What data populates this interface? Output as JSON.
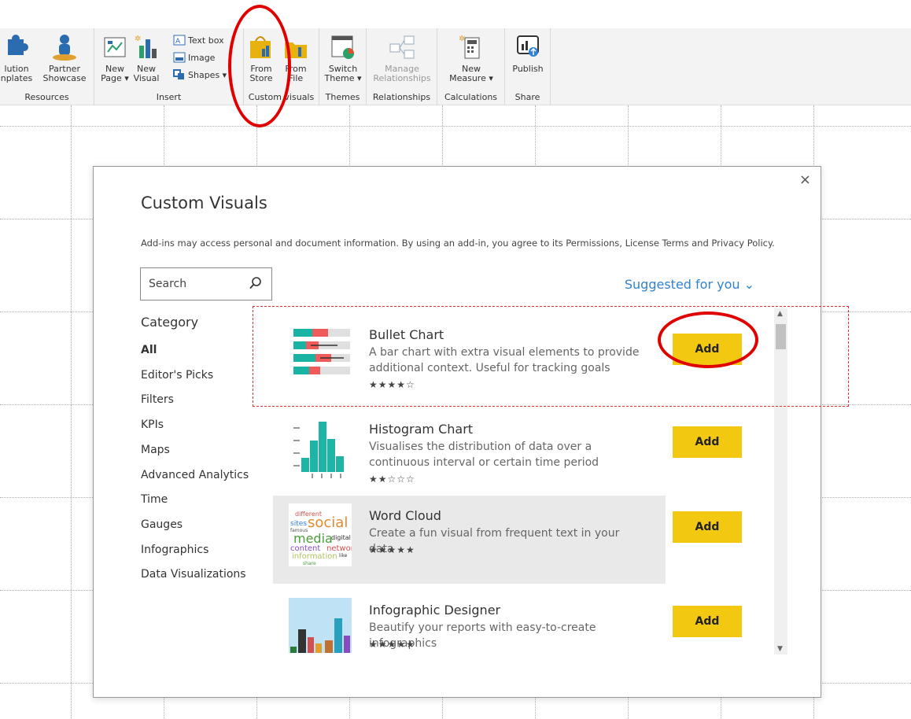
{
  "ribbon": {
    "groups": [
      {
        "label": "Resources"
      },
      {
        "label": "Insert"
      },
      {
        "label": "Custom visuals"
      },
      {
        "label": "Themes"
      },
      {
        "label": "Relationships"
      },
      {
        "label": "Calculations"
      },
      {
        "label": "Share"
      }
    ],
    "buttons": {
      "solution_templates": {
        "line1": "lution",
        "line2": "nplates"
      },
      "partner_showcase": {
        "line1": "Partner",
        "line2": "Showcase"
      },
      "new_page": {
        "line1": "New",
        "line2": "Page ▾"
      },
      "new_visual": {
        "line1": "New",
        "line2": "Visual"
      },
      "text_box": "Text box",
      "image": "Image",
      "shapes": "Shapes ▾",
      "from_store": {
        "line1": "From",
        "line2": "Store"
      },
      "from_file": {
        "line1": "From",
        "line2": "File"
      },
      "switch_theme": {
        "line1": "Switch",
        "line2": "Theme ▾"
      },
      "manage_relationships": {
        "line1": "Manage",
        "line2": "Relationships"
      },
      "new_measure": {
        "line1": "New",
        "line2": "Measure ▾"
      },
      "publish": {
        "line1": "Publish",
        "line2": ""
      }
    }
  },
  "dialog": {
    "title": "Custom Visuals",
    "close_glyph": "×",
    "note": "Add-ins may access personal and document information. By using an add-in, you agree to its Permissions, License Terms and Privacy Policy.",
    "search_placeholder": "Search",
    "suggested": "Suggested for you ⌄",
    "category_heading": "Category",
    "categories": [
      "All",
      "Editor's Picks",
      "Filters",
      "KPIs",
      "Maps",
      "Advanced Analytics",
      "Time",
      "Gauges",
      "Infographics",
      "Data Visualizations"
    ],
    "items": [
      {
        "name": "Bullet Chart",
        "desc": "A bar chart with extra visual elements to provide additional context. Useful for tracking goals",
        "stars": "★★★★☆",
        "add": "Add"
      },
      {
        "name": "Histogram Chart",
        "desc": "Visualises the distribution of data over a continuous interval or certain time period",
        "stars": "★★☆☆☆",
        "add": "Add"
      },
      {
        "name": "Word Cloud",
        "desc": "Create a fun visual from frequent text in your data",
        "stars": "★★★★★",
        "add": "Add"
      },
      {
        "name": "Infographic Designer",
        "desc": "Beautify your reports with easy-to-create infographics",
        "stars": "★★★★★",
        "add": "Add"
      }
    ],
    "word_cloud_words": [
      "different",
      "sites",
      "social",
      "famous",
      "media",
      "digital",
      "content",
      "networ",
      "information",
      "like",
      "share"
    ]
  },
  "colors": {
    "accent_yellow": "#f2c811",
    "link_blue": "#2f82d4",
    "annotation_red": "#e00000"
  }
}
